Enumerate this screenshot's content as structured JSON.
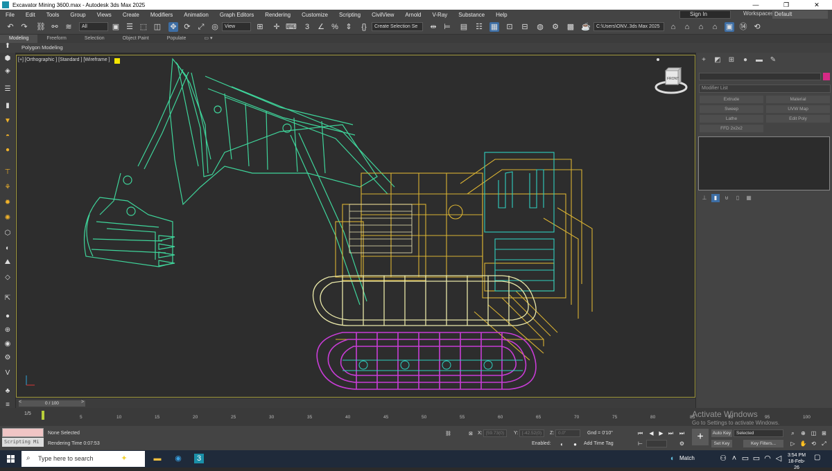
{
  "window": {
    "title": "Excavator Mining 3600.max - Autodesk 3ds Max 2025",
    "controls": [
      "—",
      "❐",
      "✕"
    ]
  },
  "menu": [
    "File",
    "Edit",
    "Tools",
    "Group",
    "Views",
    "Create",
    "Modifiers",
    "Animation",
    "Graph Editors",
    "Rendering",
    "Customize",
    "Scripting",
    "CivilView",
    "Arnold",
    "V-Ray",
    "Substance",
    "Help"
  ],
  "account": {
    "signin": "Sign In",
    "workspaces_label": "Workspaces:",
    "workspace": "Default"
  },
  "toolbar": {
    "filter": "All",
    "refcoord": "View",
    "selection_set": "Create Selection Se",
    "path": "C:\\Users\\ONV..3ds Max 2025"
  },
  "ribbon": {
    "tabs": [
      "Modeling",
      "Freeform",
      "Selection",
      "Object Paint",
      "Populate"
    ],
    "active_tab": "Modeling",
    "sub": "Polygon Modeling"
  },
  "viewport": {
    "label": "[+] [Orthographic ] [Standard ] [Wireframe ]",
    "viewcube": "FRONT"
  },
  "command_panel": {
    "modifier_list": "Modifier List",
    "buttons": [
      "Extrude",
      "Material",
      "Sweep",
      "UVW Map",
      "Lathe",
      "Edit Poly",
      "FFD 2x2x2"
    ]
  },
  "timeslider": {
    "frame": "0 / 100",
    "prev": "<",
    "next": ">"
  },
  "trackbar": {
    "ticks": [
      "5",
      "10",
      "15",
      "20",
      "25",
      "30",
      "35",
      "40",
      "45",
      "50",
      "55",
      "60",
      "65",
      "70",
      "75",
      "80",
      "85",
      "90",
      "95",
      "100"
    ],
    "label": "1/5"
  },
  "status": {
    "script_label": "Scripting Mi",
    "selection": "None Selected",
    "render_time": "Rendering Time 0:07:53",
    "x_label": "X:",
    "x_value": "[59.73(0)",
    "y_label": "Y:",
    "y_value": "[-42.52(0)",
    "z_label": "Z:",
    "z_value": "0.0\"",
    "grid": "Gnd = 0'10\"",
    "enabled": "Enabled:",
    "add_time_tag": "Add Time Tag",
    "auto_key": "Auto Key",
    "set_key": "Set Key",
    "selected": "Selected",
    "key_filters": "Key Filters..."
  },
  "watermark": {
    "line1": "Activate Windows",
    "line2": "Go to Settings to activate Windows."
  },
  "taskbar": {
    "search": "Type here to search",
    "weather": "Match",
    "time": "3:54 PM",
    "date": "18-Feb-26"
  },
  "colors": {
    "arm": "#3fd59b",
    "body": "#d9b233",
    "track_top": "#e9e7a8",
    "track_bottom": "#c83dd6",
    "cabin": "#2fd0c0",
    "accent": "#3d6ea5"
  }
}
